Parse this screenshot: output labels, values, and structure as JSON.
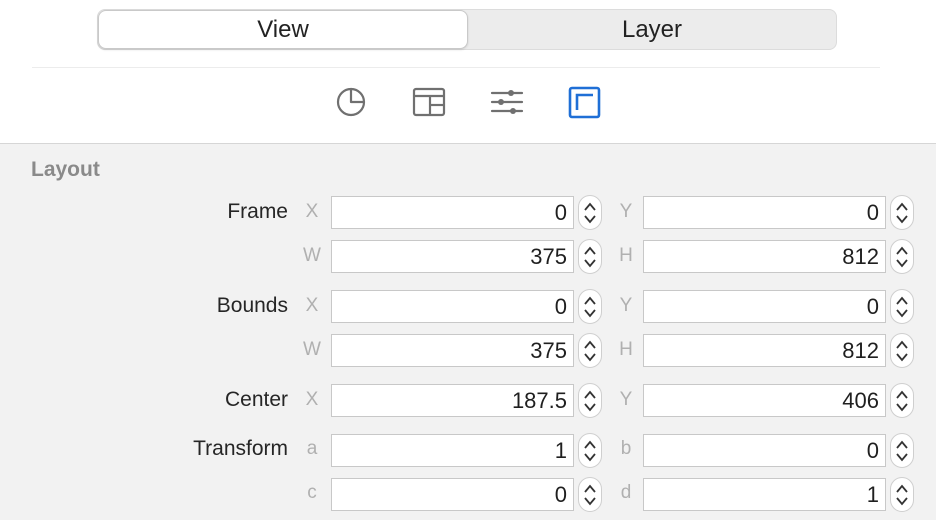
{
  "tabs": {
    "view": "View",
    "layer": "Layer"
  },
  "toolbar_icons": [
    "pie-chart-icon",
    "layout-panel-icon",
    "sliders-icon",
    "frame-corner-icon"
  ],
  "accent_color": "#1f6fd6",
  "section": {
    "title": "Layout"
  },
  "frame": {
    "label": "Frame",
    "x_axis": "X",
    "y_axis": "Y",
    "w_axis": "W",
    "h_axis": "H",
    "x": "0",
    "y": "0",
    "w": "375",
    "h": "812"
  },
  "bounds": {
    "label": "Bounds",
    "x_axis": "X",
    "y_axis": "Y",
    "w_axis": "W",
    "h_axis": "H",
    "x": "0",
    "y": "0",
    "w": "375",
    "h": "812"
  },
  "center": {
    "label": "Center",
    "x_axis": "X",
    "y_axis": "Y",
    "x": "187.5",
    "y": "406"
  },
  "transform": {
    "label": "Transform",
    "a_axis": "a",
    "b_axis": "b",
    "c_axis": "c",
    "d_axis": "d",
    "a": "1",
    "b": "0",
    "c": "0",
    "d": "1"
  }
}
